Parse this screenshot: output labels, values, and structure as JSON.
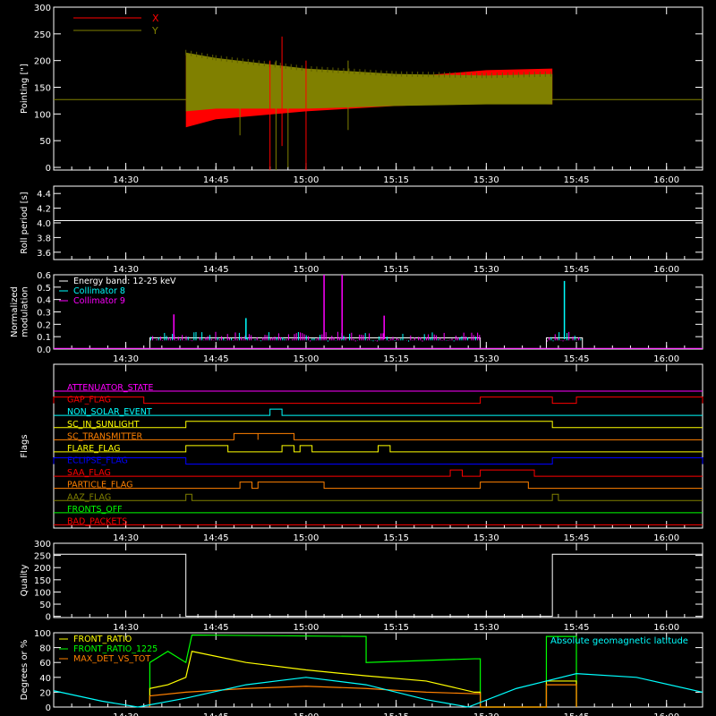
{
  "colors": {
    "background": "#000000",
    "axis": "#ffffff",
    "x_red": "#ff0000",
    "y_olive": "#808000",
    "white": "#ffffff",
    "cyan": "#00ffff",
    "magenta": "#ff00ff",
    "yellow": "#ffff00",
    "orange": "#ff8000",
    "green": "#00ff00",
    "blue": "#0000ff",
    "olive": "#808000",
    "light_green": "#80ff00"
  },
  "time_axis": {
    "range": [
      "14:18",
      "16:06"
    ],
    "ticks": [
      "14:30",
      "14:45",
      "15:00",
      "15:15",
      "15:30",
      "15:45",
      "16:00"
    ]
  },
  "chart_data": [
    {
      "id": "pointing",
      "type": "line",
      "ylabel": "Pointing [\"]",
      "ylim": [
        -5,
        300
      ],
      "yticks": [
        0,
        50,
        100,
        150,
        200,
        250,
        300
      ],
      "legend": [
        {
          "name": "X",
          "color": "#ff0000"
        },
        {
          "name": "Y",
          "color": "#808000"
        }
      ],
      "reference_level": 127,
      "series": [
        {
          "name": "X",
          "color": "#ff0000",
          "band": [
            {
              "t": "14:40",
              "min": 75,
              "max": 215
            },
            {
              "t": "14:45",
              "min": 90,
              "max": 190
            },
            {
              "t": "15:00",
              "min": 105,
              "max": 170
            },
            {
              "t": "15:15",
              "min": 115,
              "max": 168
            },
            {
              "t": "15:30",
              "min": 120,
              "max": 182
            },
            {
              "t": "15:41",
              "min": 118,
              "max": 185
            }
          ]
        },
        {
          "name": "Y",
          "color": "#808000",
          "band": [
            {
              "t": "14:40",
              "min": 105,
              "max": 215
            },
            {
              "t": "14:45",
              "min": 110,
              "max": 205
            },
            {
              "t": "15:00",
              "min": 110,
              "max": 185
            },
            {
              "t": "15:15",
              "min": 115,
              "max": 175
            },
            {
              "t": "15:30",
              "min": 118,
              "max": 172
            },
            {
              "t": "15:41",
              "min": 118,
              "max": 175
            }
          ]
        }
      ],
      "spikes": [
        {
          "t": "14:49",
          "min": 60,
          "max": 200
        },
        {
          "t": "14:54",
          "min": -5,
          "max": 200
        },
        {
          "t": "14:55",
          "min": -5,
          "max": 200
        },
        {
          "t": "14:56",
          "min": 40,
          "max": 245
        },
        {
          "t": "14:57",
          "min": 0,
          "max": 160
        },
        {
          "t": "15:00",
          "min": -5,
          "max": 200
        },
        {
          "t": "15:07",
          "min": 70,
          "max": 200
        }
      ]
    },
    {
      "id": "roll_period",
      "type": "line",
      "ylabel": "Roll period [s]",
      "ylim": [
        3.5,
        4.5
      ],
      "yticks": [
        3.6,
        3.8,
        4.0,
        4.2,
        4.4
      ],
      "series": [
        {
          "name": "",
          "color": "#ffffff",
          "x": [
            "14:18",
            "16:06"
          ],
          "y": [
            4.03,
            4.03
          ]
        }
      ]
    },
    {
      "id": "modulation",
      "type": "line",
      "ylabel": "Normalized modulation",
      "ylim": [
        0,
        0.6
      ],
      "yticks": [
        0.0,
        0.1,
        0.2,
        0.3,
        0.4,
        0.5,
        0.6
      ],
      "legend": [
        {
          "name": "Energy band: 12-25 keV",
          "color": "#ffffff"
        },
        {
          "name": "Collimator 8",
          "color": "#00ffff"
        },
        {
          "name": "Collimator 9",
          "color": "#ff00ff"
        }
      ],
      "segments": [
        {
          "start": "14:34",
          "end": "15:29",
          "level": 0.09
        },
        {
          "start": "15:40",
          "end": "15:46",
          "level": 0.09
        }
      ],
      "spikes": [
        {
          "t": "15:03",
          "y": 0.6,
          "color": "#ff00ff"
        },
        {
          "t": "15:06",
          "y": 0.6,
          "color": "#ff00ff"
        },
        {
          "t": "15:43",
          "y": 0.55,
          "color": "#00ffff"
        },
        {
          "t": "14:38",
          "y": 0.28,
          "color": "#ff00ff"
        },
        {
          "t": "14:50",
          "y": 0.25,
          "color": "#00ffff"
        },
        {
          "t": "15:13",
          "y": 0.27,
          "color": "#ff00ff"
        }
      ]
    },
    {
      "id": "flags",
      "type": "line",
      "ylabel": "Flags",
      "flags": [
        {
          "name": "ATTENUATOR_STATE",
          "color": "#ff00ff",
          "on": []
        },
        {
          "name": "GAP_FLAG",
          "color": "#ff0000",
          "on": [
            [
              "14:18",
              "14:33"
            ],
            [
              "15:29",
              "15:41"
            ],
            [
              "15:45",
              "16:06"
            ]
          ]
        },
        {
          "name": "NON_SOLAR_EVENT",
          "color": "#00ffff",
          "on": [
            [
              "14:54",
              "14:56"
            ]
          ]
        },
        {
          "name": "SC_IN_SUNLIGHT",
          "color": "#ffff00",
          "on": [
            [
              "14:40",
              "15:41"
            ]
          ]
        },
        {
          "name": "SC_TRANSMITTER",
          "color": "#ff8000",
          "on": [
            [
              "14:48",
              "14:52"
            ],
            [
              "14:52",
              "14:58"
            ]
          ]
        },
        {
          "name": "FLARE_FLAG",
          "color": "#ffff00",
          "on": [
            [
              "14:40",
              "14:47"
            ],
            [
              "14:56",
              "14:58"
            ],
            [
              "14:59",
              "15:01"
            ],
            [
              "15:12",
              "15:14"
            ]
          ]
        },
        {
          "name": "ECLIPSE_FLAG",
          "color": "#0000ff",
          "on": [
            [
              "14:18",
              "14:40"
            ],
            [
              "15:41",
              "16:06"
            ]
          ]
        },
        {
          "name": "SAA_FLAG",
          "color": "#ff0000",
          "on": [
            [
              "15:24",
              "15:26"
            ],
            [
              "15:29",
              "15:38"
            ]
          ]
        },
        {
          "name": "PARTICLE_FLAG",
          "color": "#ff8000",
          "on": [
            [
              "14:49",
              "14:51"
            ],
            [
              "14:52",
              "15:03"
            ],
            [
              "15:29",
              "15:37"
            ]
          ]
        },
        {
          "name": "AAZ_FLAG",
          "color": "#808000",
          "on": [
            [
              "14:40",
              "14:41"
            ],
            [
              "15:41",
              "15:42"
            ]
          ]
        },
        {
          "name": "FRONTS_OFF",
          "color": "#00ff00",
          "on": []
        },
        {
          "name": "BAD_PACKETS",
          "color": "#ff0000",
          "on": []
        }
      ]
    },
    {
      "id": "quality",
      "type": "line",
      "ylabel": "Quality",
      "ylim": [
        -5,
        300
      ],
      "yticks": [
        0,
        50,
        100,
        150,
        200,
        250,
        300
      ],
      "series": [
        {
          "name": "",
          "color": "#ffffff",
          "x": [
            "14:18",
            "14:40",
            "14:40",
            "15:41",
            "15:41",
            "16:06"
          ],
          "y": [
            255,
            255,
            0,
            0,
            255,
            255
          ]
        }
      ]
    },
    {
      "id": "ratios",
      "type": "line",
      "ylabel": "Degrees or %",
      "ylim": [
        0,
        100
      ],
      "yticks": [
        0,
        20,
        40,
        60,
        80,
        100
      ],
      "legend": [
        {
          "name": "FRONT_RATIO",
          "color": "#ffff00"
        },
        {
          "name": "FRONT_RATIO_1225",
          "color": "#00ff00"
        },
        {
          "name": "MAX_DET_VS_TOT",
          "color": "#ff8000"
        }
      ],
      "annotation": {
        "text": "Absolute geomagnetic latitude",
        "color": "#00ffff"
      },
      "series": [
        {
          "name": "FRONT_RATIO_1225",
          "color": "#00ff00",
          "x": [
            "14:34",
            "14:34",
            "14:37",
            "14:40",
            "14:41",
            "15:10",
            "15:10",
            "15:28",
            "15:29",
            "15:29",
            "15:40",
            "15:40",
            "15:45",
            "15:45"
          ],
          "y": [
            0,
            60,
            75,
            60,
            97,
            95,
            60,
            65,
            65,
            0,
            0,
            95,
            95,
            0
          ]
        },
        {
          "name": "FRONT_RATIO",
          "color": "#ffff00",
          "x": [
            "14:34",
            "14:34",
            "14:37",
            "14:40",
            "14:41",
            "14:50",
            "15:00",
            "15:10",
            "15:20",
            "15:28",
            "15:29",
            "15:29",
            "15:40",
            "15:40",
            "15:45",
            "15:45"
          ],
          "y": [
            0,
            25,
            30,
            40,
            75,
            60,
            50,
            42,
            35,
            20,
            20,
            0,
            0,
            35,
            35,
            0
          ]
        },
        {
          "name": "MAX_DET_VS_TOT",
          "color": "#ff8000",
          "x": [
            "14:34",
            "14:34",
            "14:40",
            "14:50",
            "15:00",
            "15:10",
            "15:20",
            "15:28",
            "15:29",
            "15:29",
            "15:40",
            "15:40",
            "15:45",
            "15:45"
          ],
          "y": [
            0,
            15,
            20,
            25,
            28,
            25,
            20,
            18,
            18,
            0,
            0,
            30,
            30,
            0
          ]
        },
        {
          "name": "Absolute geomagnetic latitude",
          "color": "#00ffff",
          "x": [
            "14:18",
            "14:26",
            "14:32",
            "14:40",
            "14:50",
            "15:00",
            "15:10",
            "15:20",
            "15:27",
            "15:35",
            "15:45",
            "15:55",
            "16:06"
          ],
          "y": [
            22,
            8,
            0,
            12,
            30,
            40,
            30,
            10,
            0,
            25,
            45,
            40,
            20
          ]
        }
      ]
    }
  ]
}
